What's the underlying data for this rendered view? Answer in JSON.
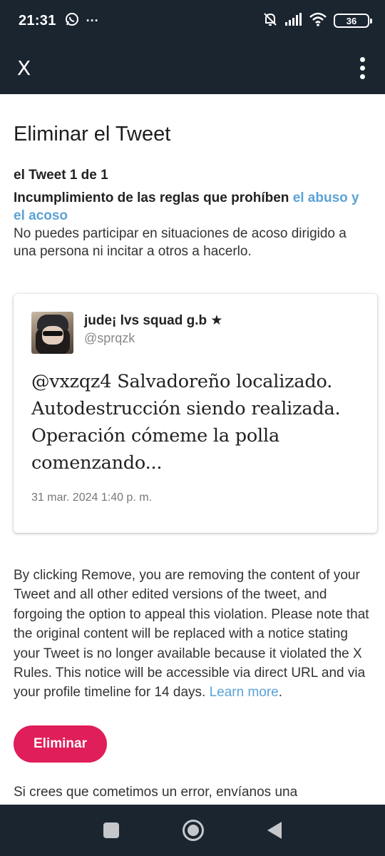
{
  "status_bar": {
    "time": "21:31",
    "more_indicator": "···",
    "battery_level": "36",
    "icons": [
      "whatsapp-icon",
      "notifications-off-icon",
      "signal-icon",
      "wifi-icon",
      "battery-icon"
    ]
  },
  "app_bar": {
    "logo": "X",
    "menu_icon": "more-vertical-icon"
  },
  "page": {
    "title": "Eliminar el Tweet",
    "tweet_count": "el Tweet 1 de 1",
    "rule_heading_prefix": "Incumplimiento de las reglas que prohíben ",
    "rule_link": "el abuso y el acoso",
    "rule_description": "No puedes participar en situaciones de acoso dirigido a una persona ni incitar a otros a hacerlo."
  },
  "tweet": {
    "display_name": "jude¡ lvs squad g.b ★",
    "handle": "@sprqzk",
    "text": "@vxzqz4 Salvadoreño localizado. Autodestrucción siendo realizada. Operación cómeme la polla comenzando...",
    "date": "31 mar. 2024 1:40 p. m."
  },
  "legal": {
    "text": "By clicking Remove, you are removing the content of your Tweet and all other edited versions of the tweet, and forgoing the option to appeal this violation. Please note that the original content will be replaced with a notice stating your Tweet is no longer available because it violated the X Rules. This notice will be accessible via direct URL and via your profile timeline for 14 days. ",
    "learn_more": "Learn more",
    "period": "."
  },
  "actions": {
    "remove_label": "Eliminar"
  },
  "footer": {
    "text": "Si crees que cometimos un error, envíanos una"
  },
  "colors": {
    "header_bg": "#1b2530",
    "link": "#5aa3d6",
    "button": "#e01e5a"
  }
}
